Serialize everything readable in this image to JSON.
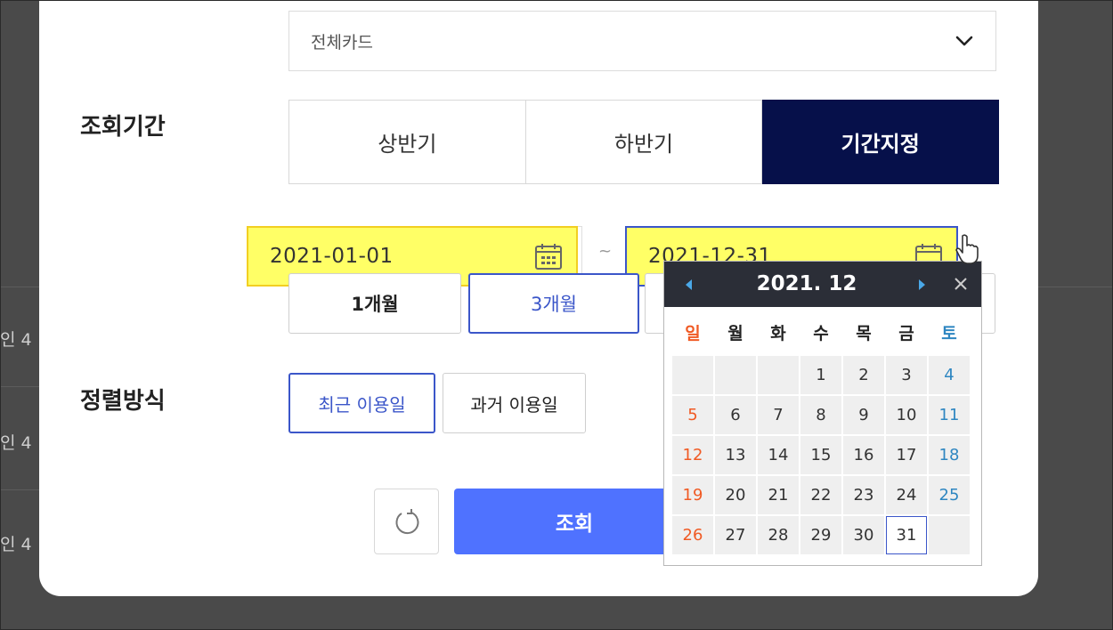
{
  "background_rows": [
    "인 4",
    "인 4",
    "인 4"
  ],
  "card_select": {
    "value": "전체카드"
  },
  "period": {
    "label": "조회기간",
    "tabs": [
      {
        "label": "상반기",
        "active": false
      },
      {
        "label": "하반기",
        "active": false
      },
      {
        "label": "기간지정",
        "active": true
      }
    ],
    "start_date": "2021-01-01",
    "separator": "~",
    "end_date": "2021-12-31",
    "quick": [
      {
        "label": "1개월",
        "active": false
      },
      {
        "label": "3개월",
        "active": true
      }
    ]
  },
  "sort": {
    "label": "정렬방식",
    "options": [
      {
        "label": "최근 이용일",
        "active": true
      },
      {
        "label": "과거 이용일",
        "active": false
      }
    ]
  },
  "actions": {
    "search_label": "조회"
  },
  "calendar": {
    "title": "2021. 12",
    "weekdays": [
      "일",
      "월",
      "화",
      "수",
      "목",
      "금",
      "토"
    ],
    "weeks": [
      [
        "",
        "",
        "",
        "1",
        "2",
        "3",
        "4"
      ],
      [
        "5",
        "6",
        "7",
        "8",
        "9",
        "10",
        "11"
      ],
      [
        "12",
        "13",
        "14",
        "15",
        "16",
        "17",
        "18"
      ],
      [
        "19",
        "20",
        "21",
        "22",
        "23",
        "24",
        "25"
      ],
      [
        "26",
        "27",
        "28",
        "29",
        "30",
        "31",
        ""
      ]
    ],
    "selected_day": "31"
  },
  "colors": {
    "accent": "#3b56c9",
    "active_tab": "#06104a",
    "search_button": "#4f72ff",
    "highlight": "#ffff66",
    "sunday": "#f05a24",
    "saturday": "#2e86c1"
  }
}
